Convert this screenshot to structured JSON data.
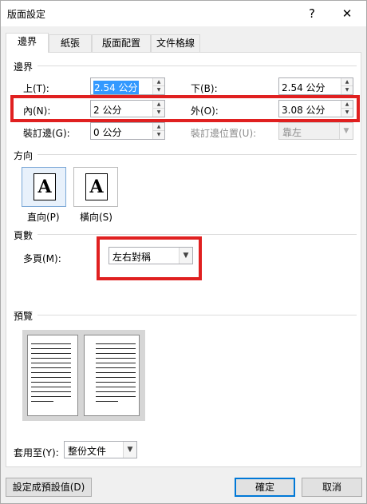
{
  "window": {
    "title": "版面設定",
    "help": "?",
    "close": "✕"
  },
  "tabs": [
    {
      "label": "邊界"
    },
    {
      "label": "紙張"
    },
    {
      "label": "版面配置"
    },
    {
      "label": "文件格線"
    }
  ],
  "margins": {
    "section_title": "邊界",
    "top": {
      "label": "上(T):",
      "value": "2.54 公分"
    },
    "bottom": {
      "label": "下(B):",
      "value": "2.54 公分"
    },
    "inside": {
      "label": "內(N):",
      "value": "2 公分"
    },
    "outside": {
      "label": "外(O):",
      "value": "3.08 公分"
    },
    "gutter": {
      "label": "裝訂邊(G):",
      "value": "0 公分"
    },
    "gutter_pos": {
      "label": "裝訂邊位置(U):",
      "value": "靠左"
    }
  },
  "orientation": {
    "section_title": "方向",
    "glyph": "A",
    "portrait": "直向(P)",
    "landscape": "橫向(S)"
  },
  "pages": {
    "section_title": "頁數",
    "multiple_label": "多頁(M):",
    "multiple_value": "左右對稱"
  },
  "preview": {
    "section_title": "預覽"
  },
  "apply_to": {
    "label": "套用至(Y):",
    "value": "整份文件"
  },
  "buttons": {
    "set_default": "設定成預設值(D)",
    "ok": "確定",
    "cancel": "取消"
  },
  "colors": {
    "highlight": "#e02020",
    "selection": "#3399ff",
    "accent": "#0078d7"
  }
}
